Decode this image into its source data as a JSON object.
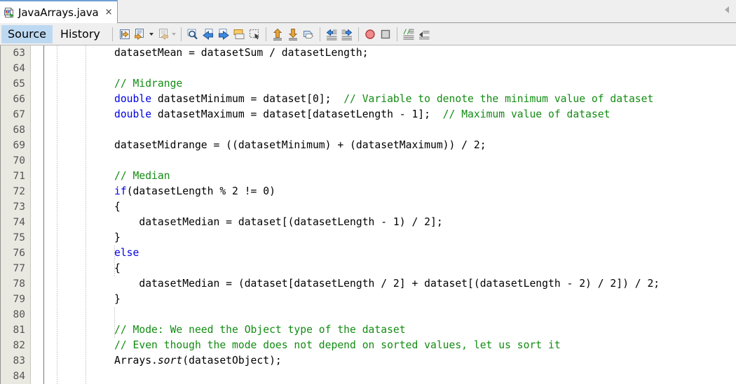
{
  "tab_bar": {
    "document_tab": {
      "icon": "java-file-icon",
      "label": "JavaArrays.java",
      "close_label": "×"
    },
    "scroll_left_icon": "chevron-left-icon"
  },
  "toolbar": {
    "view_tabs": [
      {
        "label": "Source",
        "active": true
      },
      {
        "label": "History",
        "active": false
      }
    ],
    "buttons": [
      {
        "name": "last-edit-position-icon",
        "enabled": true
      },
      {
        "name": "back-navigation-icon",
        "enabled": true
      },
      {
        "name": "back-dropdown-arrow",
        "enabled": true
      },
      {
        "name": "forward-navigation-icon",
        "enabled": false
      },
      {
        "name": "forward-dropdown-arrow",
        "enabled": false
      },
      {
        "name": "find-selection-icon",
        "enabled": true
      },
      {
        "name": "find-previous-icon",
        "enabled": true
      },
      {
        "name": "find-next-icon",
        "enabled": true
      },
      {
        "name": "toggle-highlight-search-icon",
        "enabled": true
      },
      {
        "name": "toggle-rectangular-selection-icon",
        "enabled": true
      },
      {
        "name": "previous-bookmark-icon",
        "enabled": true
      },
      {
        "name": "next-bookmark-icon",
        "enabled": true
      },
      {
        "name": "toggle-bookmark-icon",
        "enabled": true
      },
      {
        "name": "shift-line-left-icon",
        "enabled": true
      },
      {
        "name": "shift-line-right-icon",
        "enabled": true
      },
      {
        "name": "start-macro-recording-icon",
        "enabled": true
      },
      {
        "name": "stop-macro-recording-icon",
        "enabled": true
      },
      {
        "name": "comment-icon",
        "enabled": true
      },
      {
        "name": "uncomment-icon",
        "enabled": true
      }
    ]
  },
  "editor": {
    "first_line_number": 63,
    "lines": [
      {
        "num": "63",
        "tokens": [
          {
            "t": "        datasetMean = datasetSum / datasetLength;",
            "c": ""
          }
        ]
      },
      {
        "num": "64",
        "tokens": [
          {
            "t": "",
            "c": ""
          }
        ]
      },
      {
        "num": "65",
        "tokens": [
          {
            "t": "        ",
            "c": ""
          },
          {
            "t": "// Midrange",
            "c": "cmt"
          }
        ]
      },
      {
        "num": "66",
        "tokens": [
          {
            "t": "        ",
            "c": ""
          },
          {
            "t": "double",
            "c": "kw"
          },
          {
            "t": " datasetMinimum = dataset[0];  ",
            "c": ""
          },
          {
            "t": "// Variable to denote the minimum value of dataset",
            "c": "cmt"
          }
        ]
      },
      {
        "num": "67",
        "tokens": [
          {
            "t": "        ",
            "c": ""
          },
          {
            "t": "double",
            "c": "kw"
          },
          {
            "t": " datasetMaximum = dataset[datasetLength - 1];  ",
            "c": ""
          },
          {
            "t": "// Maximum value of dataset",
            "c": "cmt"
          }
        ]
      },
      {
        "num": "68",
        "tokens": [
          {
            "t": "",
            "c": ""
          }
        ]
      },
      {
        "num": "69",
        "tokens": [
          {
            "t": "        datasetMidrange = ((datasetMinimum) + (datasetMaximum)) / 2;",
            "c": ""
          }
        ]
      },
      {
        "num": "70",
        "tokens": [
          {
            "t": "",
            "c": ""
          }
        ]
      },
      {
        "num": "71",
        "tokens": [
          {
            "t": "        ",
            "c": ""
          },
          {
            "t": "// Median",
            "c": "cmt"
          }
        ]
      },
      {
        "num": "72",
        "tokens": [
          {
            "t": "        ",
            "c": ""
          },
          {
            "t": "if",
            "c": "kw"
          },
          {
            "t": "(datasetLength % 2 != 0)",
            "c": ""
          }
        ]
      },
      {
        "num": "73",
        "tokens": [
          {
            "t": "        {",
            "c": ""
          }
        ]
      },
      {
        "num": "74",
        "tokens": [
          {
            "t": "            datasetMedian = dataset[(datasetLength - 1) / 2];",
            "c": ""
          }
        ]
      },
      {
        "num": "75",
        "tokens": [
          {
            "t": "        }",
            "c": ""
          }
        ]
      },
      {
        "num": "76",
        "tokens": [
          {
            "t": "        ",
            "c": ""
          },
          {
            "t": "else",
            "c": "kw"
          }
        ]
      },
      {
        "num": "77",
        "tokens": [
          {
            "t": "        {",
            "c": ""
          }
        ]
      },
      {
        "num": "78",
        "tokens": [
          {
            "t": "            datasetMedian = (dataset[datasetLength / 2] + dataset[(datasetLength - 2) / 2]) / 2;",
            "c": ""
          }
        ]
      },
      {
        "num": "79",
        "tokens": [
          {
            "t": "        }",
            "c": ""
          }
        ]
      },
      {
        "num": "80",
        "tokens": [
          {
            "t": "",
            "c": ""
          }
        ]
      },
      {
        "num": "81",
        "tokens": [
          {
            "t": "        ",
            "c": ""
          },
          {
            "t": "// Mode: We need the Object type of the dataset",
            "c": "cmt"
          }
        ]
      },
      {
        "num": "82",
        "tokens": [
          {
            "t": "        ",
            "c": ""
          },
          {
            "t": "// Even though the mode does not depend on sorted values, let us sort it",
            "c": "cmt"
          }
        ]
      },
      {
        "num": "83",
        "tokens": [
          {
            "t": "        Arrays.",
            "c": ""
          },
          {
            "t": "sort",
            "c": "stat"
          },
          {
            "t": "(datasetObject);",
            "c": ""
          }
        ]
      },
      {
        "num": "84",
        "tokens": [
          {
            "t": "",
            "c": ""
          }
        ]
      }
    ],
    "colors": {
      "keyword": "#0000e6",
      "comment": "#128c12",
      "plain": "#000000",
      "gutter_bg": "#e9e9e2",
      "gutter_fg": "#555555",
      "background": "#ffffff"
    }
  }
}
